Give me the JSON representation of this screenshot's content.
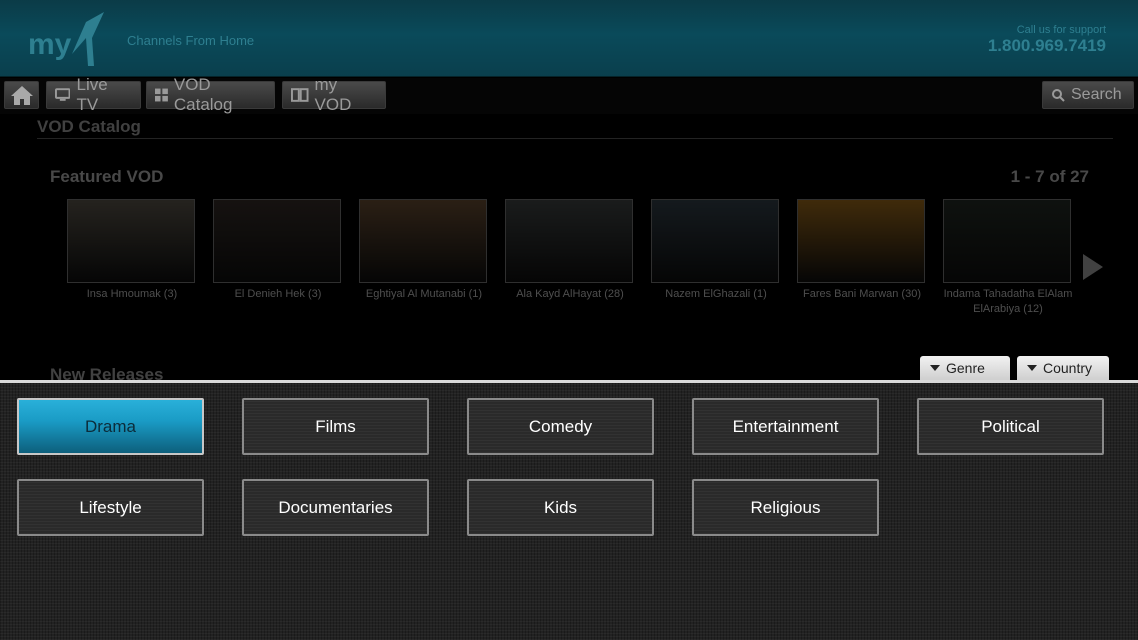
{
  "header": {
    "logo_text": "myTV",
    "tagline": "Channels From Home",
    "support_label": "Call us for support",
    "support_phone": "1.800.969.7419"
  },
  "nav": {
    "home_icon": "home-icon",
    "live_tv": "Live TV",
    "vod_catalog": "VOD Catalog",
    "my_vod": "my VOD",
    "search": "Search"
  },
  "page": {
    "title": "VOD Catalog",
    "featured_title": "Featured VOD",
    "featured_count": "1 - 7 of 27",
    "new_releases": "New Releases",
    "genre_button": "Genre",
    "country_button": "Country"
  },
  "featured": [
    {
      "title": "Insa Hmoumak (3)",
      "color": "#6a6458"
    },
    {
      "title": "El Denieh Hek (3)",
      "color": "#3f3530"
    },
    {
      "title": "Eghtiyal Al Mutanabi (1)",
      "color": "#7a5a3c"
    },
    {
      "title": "Ala Kayd AlHayat (28)",
      "color": "#4b5050"
    },
    {
      "title": "Nazem ElGhazali (1)",
      "color": "#3b4a55"
    },
    {
      "title": "Fares Bani Marwan (30)",
      "color": "#b57a20"
    },
    {
      "title": "Indama Tahadatha ElAlam ElArabiya (12)",
      "color": "#2a332c"
    }
  ],
  "genres": [
    {
      "label": "Drama",
      "selected": true
    },
    {
      "label": "Films",
      "selected": false
    },
    {
      "label": "Comedy",
      "selected": false
    },
    {
      "label": "Entertainment",
      "selected": false
    },
    {
      "label": "Political",
      "selected": false
    },
    {
      "label": "Lifestyle",
      "selected": false
    },
    {
      "label": "Documentaries",
      "selected": false
    },
    {
      "label": "Kids",
      "selected": false
    },
    {
      "label": "Religious",
      "selected": false
    }
  ],
  "colors": {
    "accent": "#1a9bc5",
    "header": "#0a4a5a"
  }
}
